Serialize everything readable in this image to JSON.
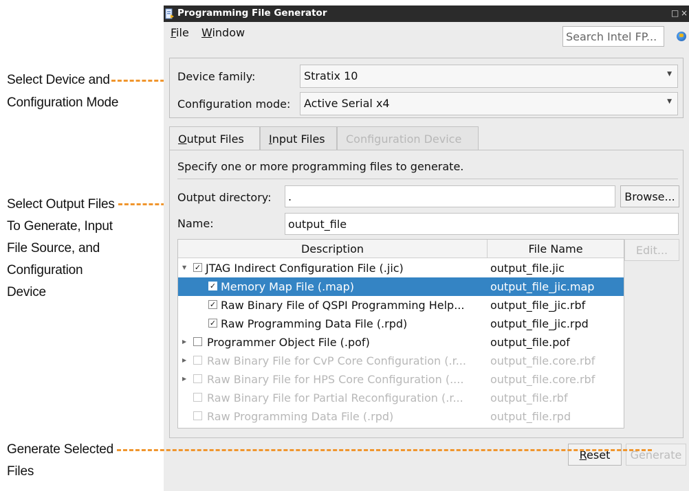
{
  "annotations": {
    "device_l1": "Select Device and",
    "device_l2": "Configuration Mode",
    "output_l1": "Select Output Files",
    "output_l2": "To Generate, Input",
    "output_l3": "File Source, and",
    "output_l4": "Configuration",
    "output_l5": "Device",
    "generate_l1": "Generate Selected",
    "generate_l2": "Files"
  },
  "window": {
    "title": "Programming File Generator",
    "minimize": "□",
    "close": "×"
  },
  "menu": {
    "file_rest": "ile",
    "file_key": "F",
    "window_rest": "indow",
    "window_key": "W"
  },
  "search": {
    "placeholder": "Search Intel FP..."
  },
  "device": {
    "family_label": "Device family:",
    "family_value": "Stratix 10",
    "mode_label": "Configuration mode:",
    "mode_value": "Active Serial x4"
  },
  "tabs": {
    "output_key": "O",
    "output_rest": "utput Files",
    "input_key": "I",
    "input_rest": "nput Files",
    "config": "Configuration Device"
  },
  "panel": {
    "instructions": "Specify one or more programming files to generate.",
    "output_dir_label": "Output directory:",
    "output_dir_value": ".",
    "browse": "Browse...",
    "name_label": "Name:",
    "name_value": "output_file",
    "edit": "Edit..."
  },
  "table": {
    "col_description": "Description",
    "col_filename": "File Name",
    "rows": [
      {
        "description": "JTAG Indirect Configuration File (.jic)",
        "file": "output_file.jic"
      },
      {
        "description": "Memory Map File (.map)",
        "file": "output_file_jic.map"
      },
      {
        "description": "Raw Binary File of QSPI Programming Help...",
        "file": "output_file_jic.rbf"
      },
      {
        "description": "Raw Programming Data File (.rpd)",
        "file": "output_file_jic.rpd"
      },
      {
        "description": "Programmer Object File (.pof)",
        "file": "output_file.pof"
      },
      {
        "description": "Raw Binary File for CvP Core Configuration (.r...",
        "file": "output_file.core.rbf"
      },
      {
        "description": "Raw Binary File for HPS Core Configuration (....",
        "file": "output_file.core.rbf"
      },
      {
        "description": "Raw Binary File for Partial Reconfiguration (.r...",
        "file": "output_file.rbf"
      },
      {
        "description": "Raw Programming Data File (.rpd)",
        "file": "output_file.rpd"
      }
    ]
  },
  "buttons": {
    "reset_key": "R",
    "reset_rest": "eset",
    "generate": "Generate"
  },
  "colors": {
    "annotation_line": "#f0962e",
    "selection": "#3484c4"
  }
}
